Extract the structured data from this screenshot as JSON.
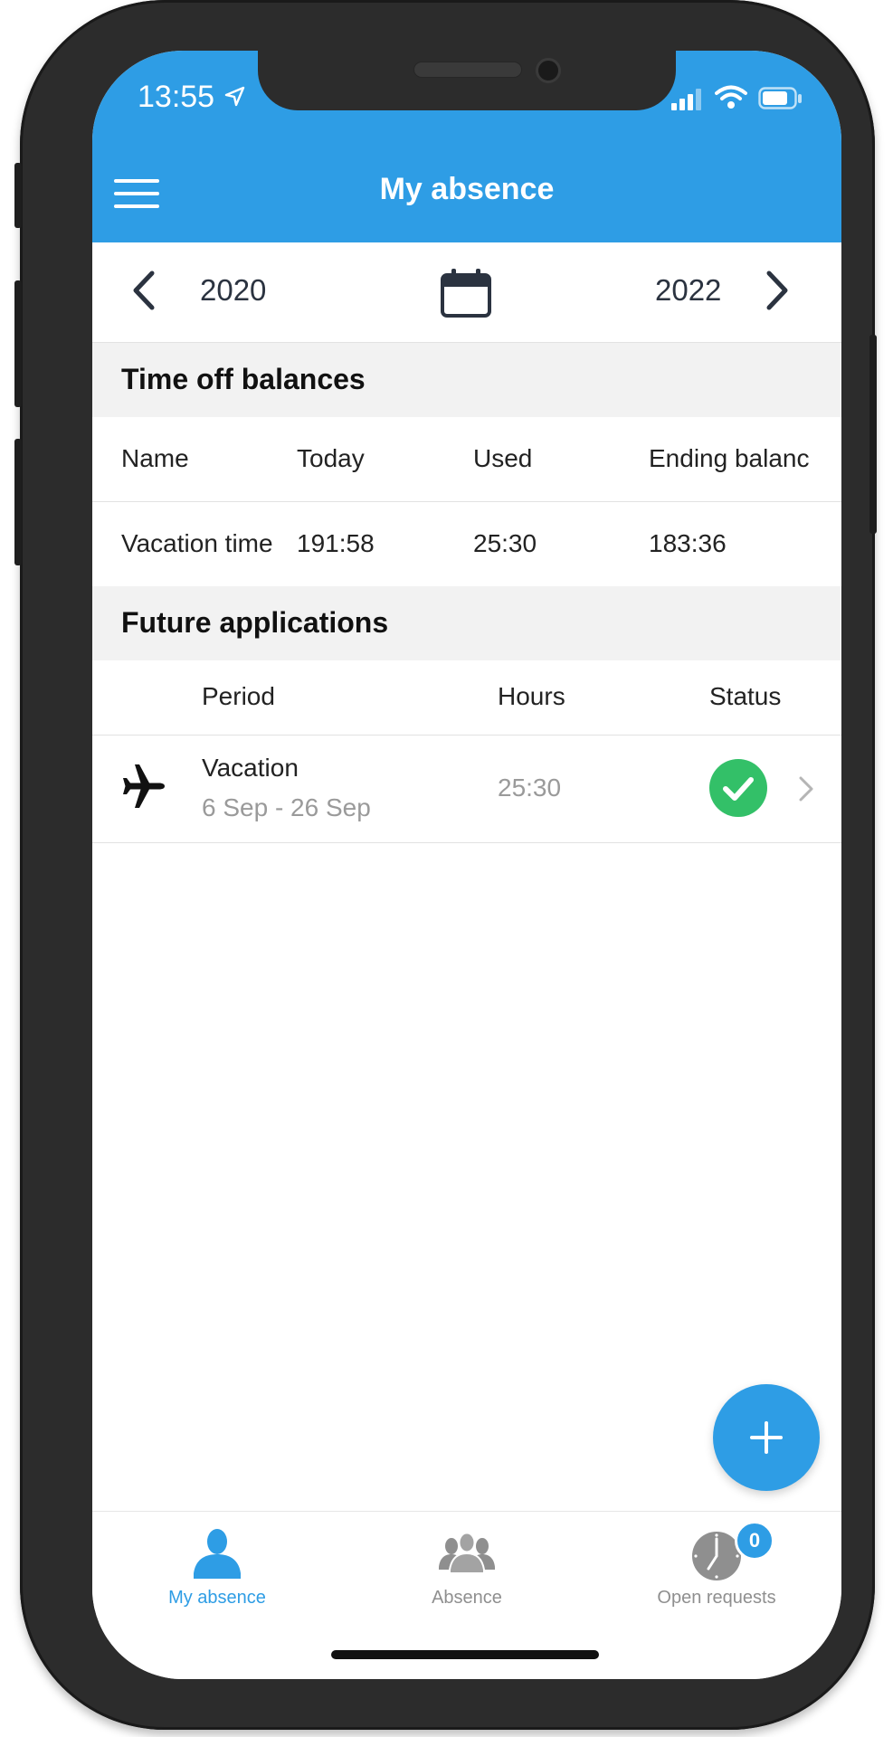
{
  "status_bar": {
    "time": "13:55"
  },
  "header": {
    "title": "My absence"
  },
  "year_nav": {
    "prev_year": "2020",
    "next_year": "2022"
  },
  "balances": {
    "section_title": "Time off balances",
    "columns": [
      "Name",
      "Today",
      "Used",
      "Ending balanc"
    ],
    "rows": [
      {
        "name": "Vacation time",
        "today": "191:58",
        "used": "25:30",
        "ending": "183:36"
      }
    ]
  },
  "applications": {
    "section_title": "Future applications",
    "columns": {
      "period": "Period",
      "hours": "Hours",
      "status": "Status"
    },
    "items": [
      {
        "type": "Vacation",
        "period": "6 Sep - 26 Sep",
        "hours": "25:30",
        "status_icon": "check-circle-icon",
        "status_color": "#33c068"
      }
    ]
  },
  "tabbar": {
    "tabs": [
      {
        "label": "My absence",
        "icon": "person-icon",
        "active": true
      },
      {
        "label": "Absence",
        "icon": "group-icon",
        "active": false
      },
      {
        "label": "Open requests",
        "icon": "clock-icon",
        "active": false,
        "badge": "0"
      }
    ]
  },
  "colors": {
    "accent": "#2e9de5",
    "success": "#33c068",
    "frame": "#2c2c2c"
  }
}
